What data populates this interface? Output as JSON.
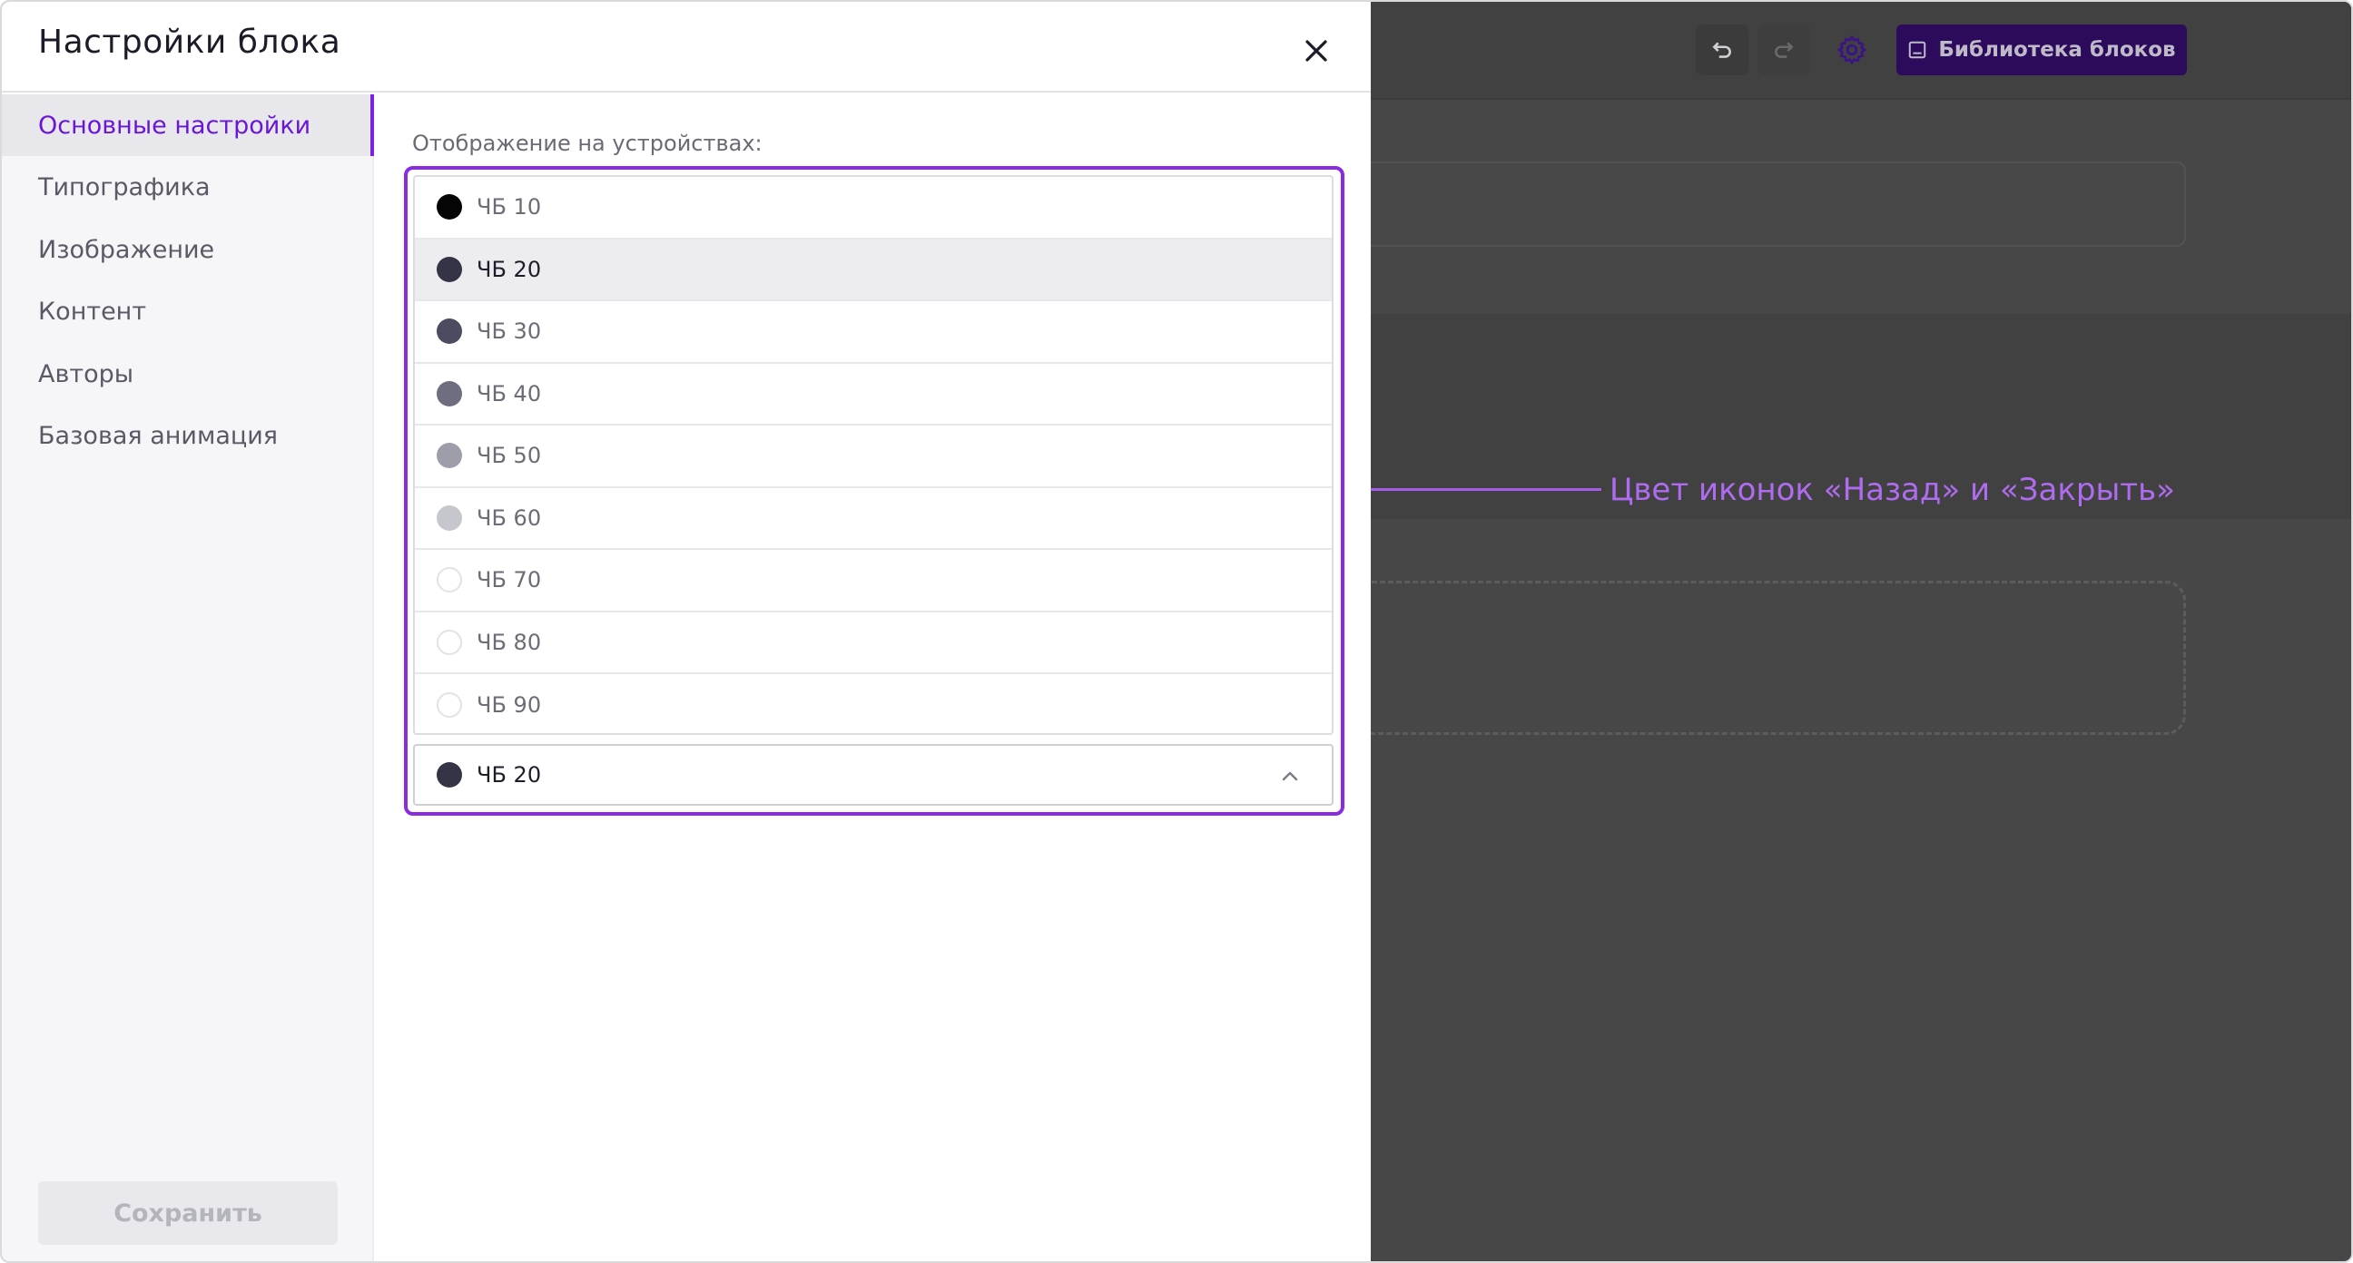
{
  "modal": {
    "title": "Настройки блока",
    "close_icon": "close-icon"
  },
  "sidebar": {
    "items": [
      {
        "label": "Основные настройки",
        "active": true
      },
      {
        "label": "Типографика",
        "active": false
      },
      {
        "label": "Изображение",
        "active": false
      },
      {
        "label": "Контент",
        "active": false
      },
      {
        "label": "Авторы",
        "active": false
      },
      {
        "label": "Базовая анимация",
        "active": false
      }
    ],
    "save_label": "Сохранить"
  },
  "field": {
    "label": "Отображение на устройствах:",
    "options": [
      {
        "label": "ЧБ 10",
        "color": "#050505"
      },
      {
        "label": "ЧБ 20",
        "color": "#353447"
      },
      {
        "label": "ЧБ 30",
        "color": "#4b4b61"
      },
      {
        "label": "ЧБ 40",
        "color": "#6e6e80"
      },
      {
        "label": "ЧБ 50",
        "color": "#9e9eaa"
      },
      {
        "label": "ЧБ 60",
        "color": "#c6c6cd"
      },
      {
        "label": "ЧБ 70",
        "color": "#ffffff"
      },
      {
        "label": "ЧБ 80",
        "color": "#ffffff"
      },
      {
        "label": "ЧБ 90",
        "color": "#ffffff"
      }
    ],
    "hovered_option": "ЧБ 20",
    "selected": {
      "label": "ЧБ 20",
      "color": "#353447"
    },
    "chevron_icon": "chevron-up-icon"
  },
  "toolbar": {
    "undo_icon": "undo-icon",
    "redo_icon": "redo-icon",
    "gear_icon": "gear-icon",
    "library_icon": "image-icon",
    "library_label": "Библиотека блоков"
  },
  "annotation": {
    "text": "Цвет иконок «Назад» и «Закрыть»",
    "color": "#b06cf0"
  },
  "colors": {
    "accent": "#7a22e0",
    "highlight_border": "#8a2be2",
    "overlay": "#474747"
  }
}
